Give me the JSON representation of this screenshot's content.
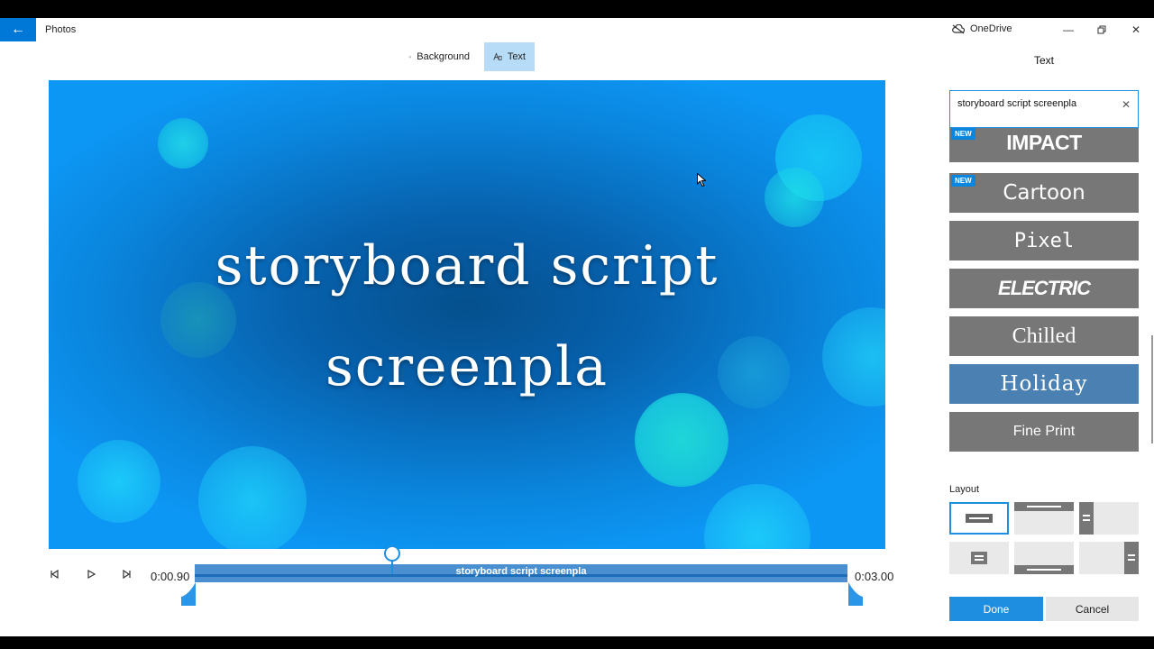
{
  "window": {
    "app_title": "Photos",
    "onedrive_label": "OneDrive",
    "back_icon": "arrow-left-icon",
    "minimize_icon": "minimize-icon",
    "restore_icon": "restore-icon",
    "close_icon": "close-icon"
  },
  "toolbar": {
    "background_label": "Background",
    "text_label": "Text",
    "active_tab": "Text"
  },
  "preview": {
    "line1": "storyboard script",
    "line2": "screenpla",
    "background_color": "#0a86de"
  },
  "timeline": {
    "start_time": "0:00.90",
    "end_time": "0:03.00",
    "clip_label": "storyboard script screenpla"
  },
  "panel": {
    "title": "Text",
    "search_value": "storyboard script screenpla",
    "styles": [
      {
        "name": "IMPACT",
        "badge": "NEW"
      },
      {
        "name": "Cartoon",
        "badge": "NEW"
      },
      {
        "name": "Pixel",
        "badge": ""
      },
      {
        "name": "ELECTRIC",
        "badge": ""
      },
      {
        "name": "Chilled",
        "badge": ""
      },
      {
        "name": "Holiday",
        "badge": ""
      },
      {
        "name": "Fine Print",
        "badge": ""
      }
    ],
    "selected_style": "Holiday",
    "layout_label": "Layout",
    "done_label": "Done",
    "cancel_label": "Cancel",
    "accent_color": "#1e8fe0"
  }
}
